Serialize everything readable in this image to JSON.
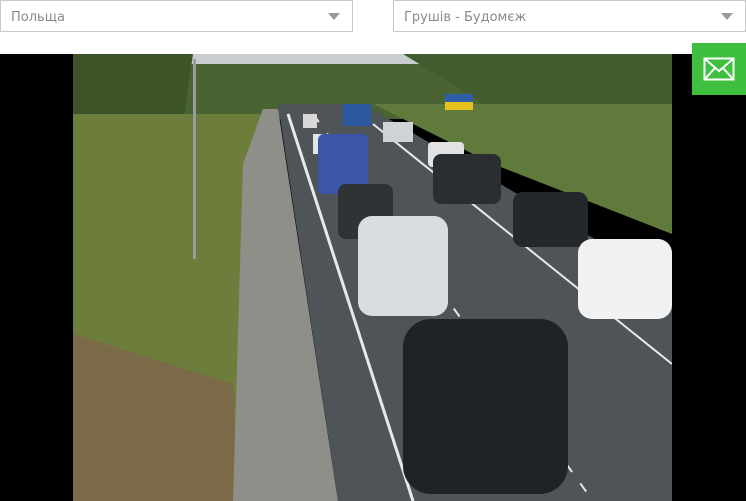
{
  "selectors": {
    "country": {
      "value": "Польща",
      "icon": "chevron-down-icon"
    },
    "crossing": {
      "value": "Грушів - Будомєж",
      "icon": "chevron-down-icon"
    }
  },
  "camera": {
    "description": "live-camera-feed",
    "colors": {
      "sky": "#c9ced2",
      "road": "#4d5256",
      "grass": "#6f7f3f",
      "trees": "#3f5a2c"
    }
  },
  "mail_button": {
    "icon": "envelope-icon",
    "color": "#3fbf3f"
  }
}
